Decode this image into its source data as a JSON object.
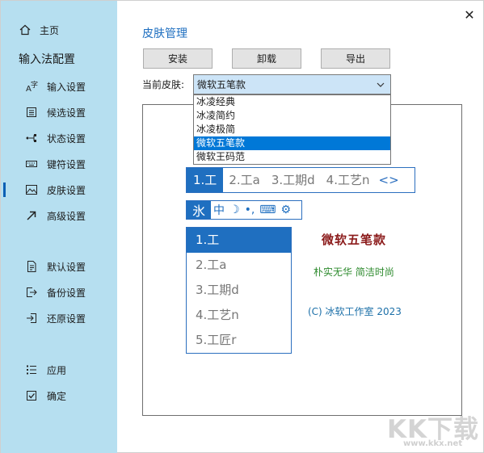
{
  "window": {
    "close_label": "✕"
  },
  "sidebar": {
    "home_label": "主页",
    "section_title": "输入法配置",
    "items": [
      {
        "label": "输入设置",
        "icon": "text-input-icon"
      },
      {
        "label": "候选设置",
        "icon": "candidate-list-icon"
      },
      {
        "label": "状态设置",
        "icon": "status-icon"
      },
      {
        "label": "键符设置",
        "icon": "keyboard-icon"
      },
      {
        "label": "皮肤设置",
        "icon": "image-icon"
      },
      {
        "label": "高级设置",
        "icon": "arrow-up-right-icon"
      },
      {
        "label": "默认设置",
        "icon": "document-icon"
      },
      {
        "label": "备份设置",
        "icon": "export-icon"
      },
      {
        "label": "还原设置",
        "icon": "import-icon"
      },
      {
        "label": "应用",
        "icon": "list-icon"
      },
      {
        "label": "确定",
        "icon": "checkbox-icon"
      }
    ],
    "active_index": 4
  },
  "main": {
    "title": "皮肤管理",
    "buttons": {
      "install": "安装",
      "uninstall": "卸载",
      "export": "导出"
    },
    "current_skin_label": "当前皮肤:",
    "current_skin_value": "微软五笔款",
    "options": [
      "冰凌经典",
      "冰凌简约",
      "冰凌极简",
      "微软五笔款",
      "微软王码范"
    ],
    "selected_option_index": 3
  },
  "preview": {
    "h_candidates": [
      "1.工",
      "2.工a",
      "3.工期d",
      "4.工艺n"
    ],
    "h_nav": "<>",
    "status_items": [
      "氷",
      "中",
      "☽",
      "•,",
      "⌨",
      "⚙"
    ],
    "v_candidates": [
      "1.工",
      "2.工a",
      "3.工期d",
      "4.工艺n",
      "5.工匠r"
    ],
    "skin_name": "微软五笔款",
    "slogan": "朴实无华 简洁时尚",
    "copyright": "(C) 冰软工作室 2023"
  },
  "watermark": {
    "text": "KK下载",
    "url": "www.kkx.net"
  },
  "colors": {
    "sidebar_bg": "#b6dff0",
    "accent": "#1f6fc0",
    "selected": "#0078d7",
    "skin_name": "#8b1a1a",
    "slogan": "#2e8b2e"
  }
}
